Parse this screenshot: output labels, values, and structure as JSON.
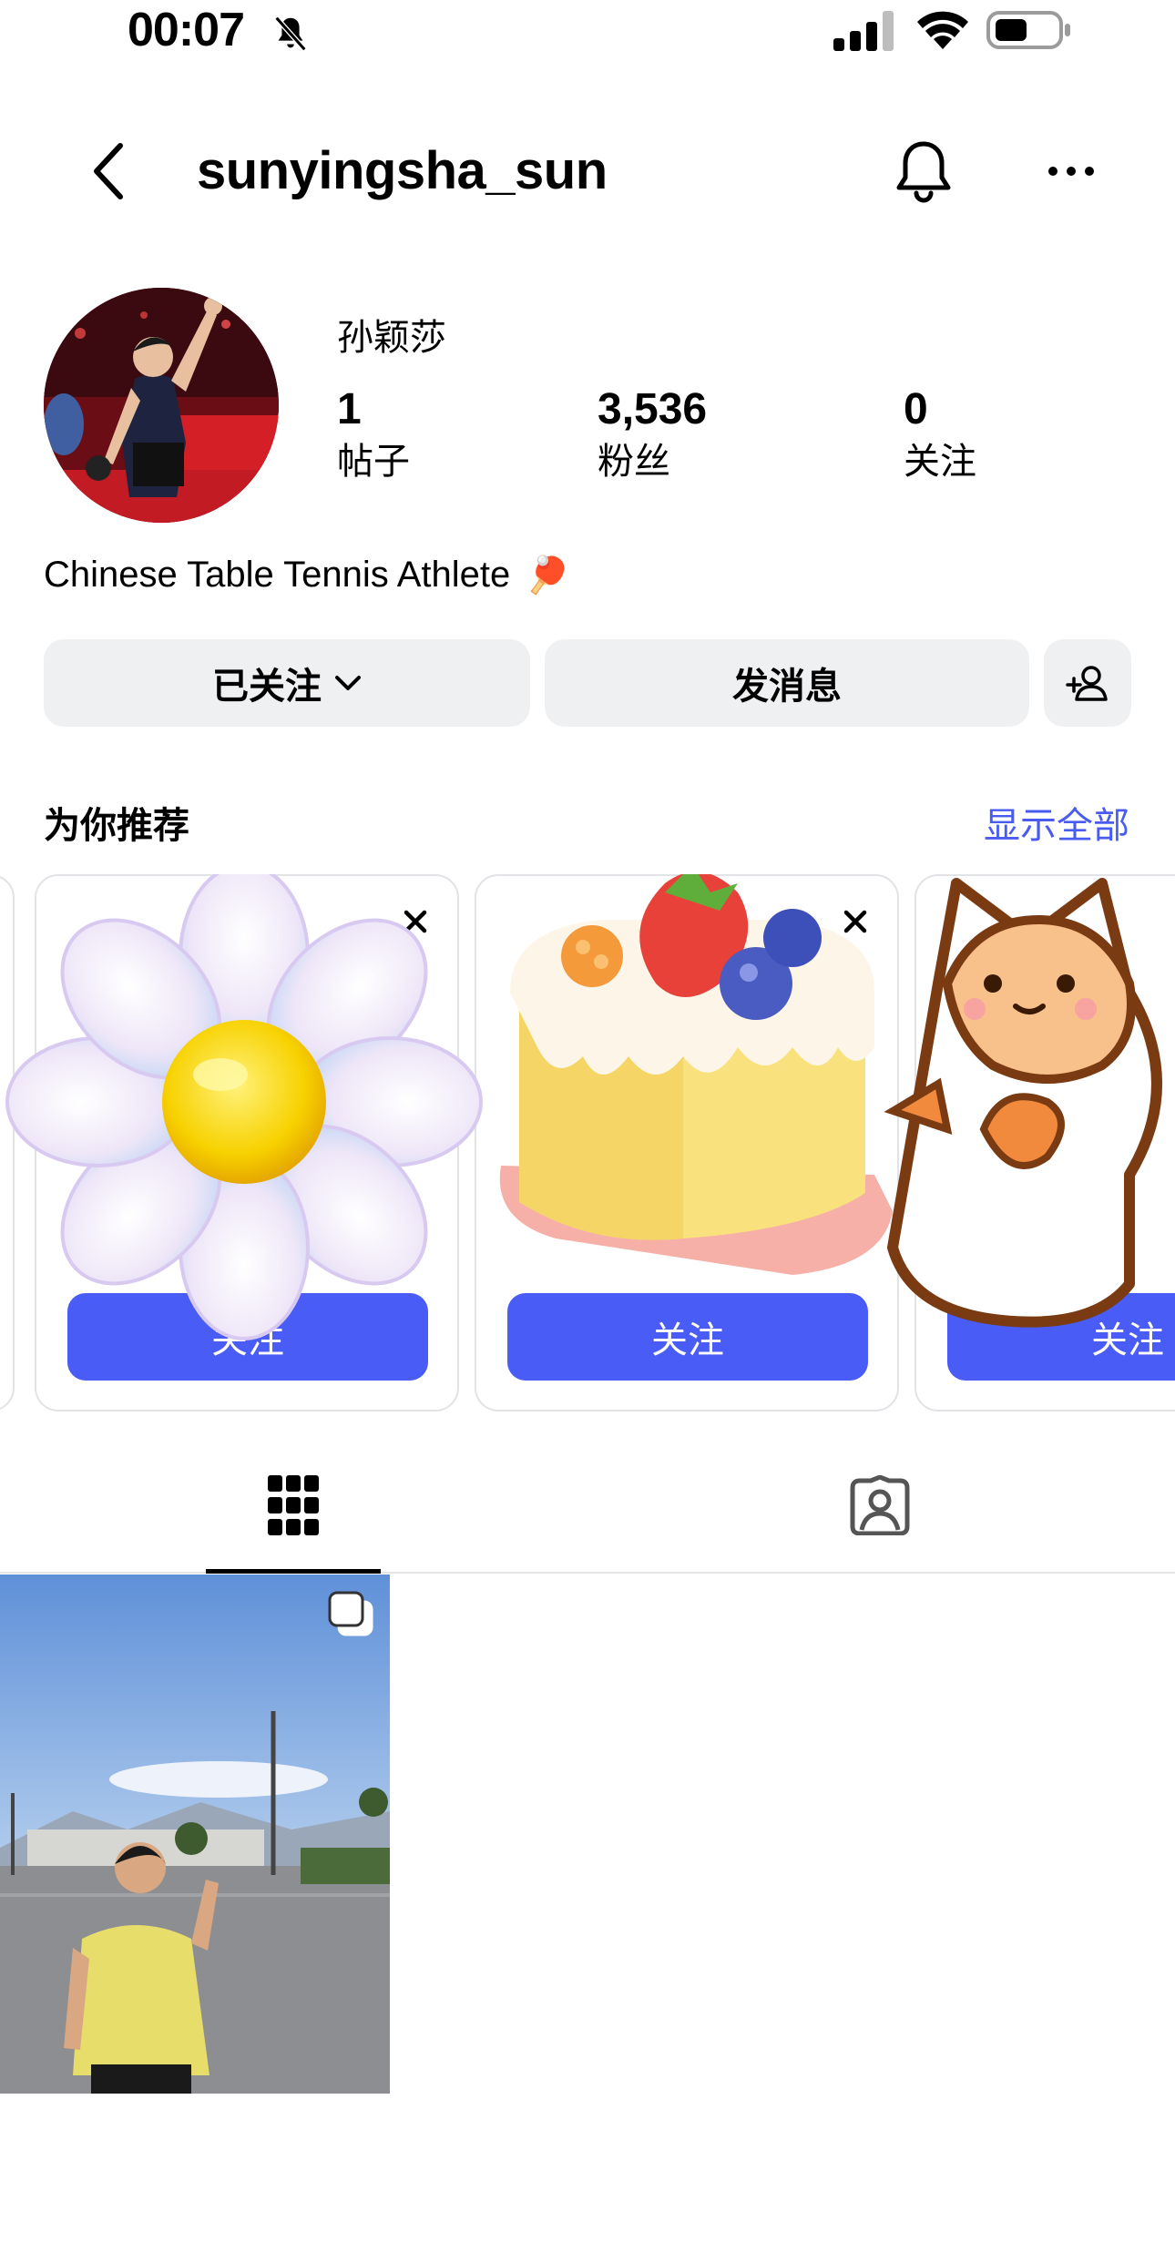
{
  "status_bar": {
    "time": "00:07"
  },
  "header": {
    "username": "sunyingsha_sun"
  },
  "profile": {
    "display_name": "孙颖莎",
    "stats": [
      {
        "value": "1",
        "label": "帖子"
      },
      {
        "value": "3,536",
        "label": "粉丝"
      },
      {
        "value": "0",
        "label": "关注"
      }
    ],
    "bio": "Chinese Table Tennis Athlete",
    "bio_emoji": "🏓"
  },
  "actions": {
    "following_label": "已关注",
    "message_label": "发消息"
  },
  "suggestions": {
    "title": "为你推荐",
    "see_all": "显示全部",
    "cards": [
      {
        "follow_label": "关注"
      },
      {
        "follow_label": "关注"
      },
      {
        "follow_label": "关注"
      }
    ]
  },
  "colors": {
    "accent": "#4a5cf6",
    "link": "#4a5cf0",
    "button_bg": "#eff0f2"
  },
  "icons": {
    "status": [
      "bell-slash-icon",
      "signal-icon",
      "wifi-icon",
      "battery-icon"
    ],
    "nav": [
      "chevron-left-icon",
      "bell-icon",
      "more-icon"
    ],
    "tabs": [
      "grid-icon",
      "tagged-person-icon"
    ]
  }
}
